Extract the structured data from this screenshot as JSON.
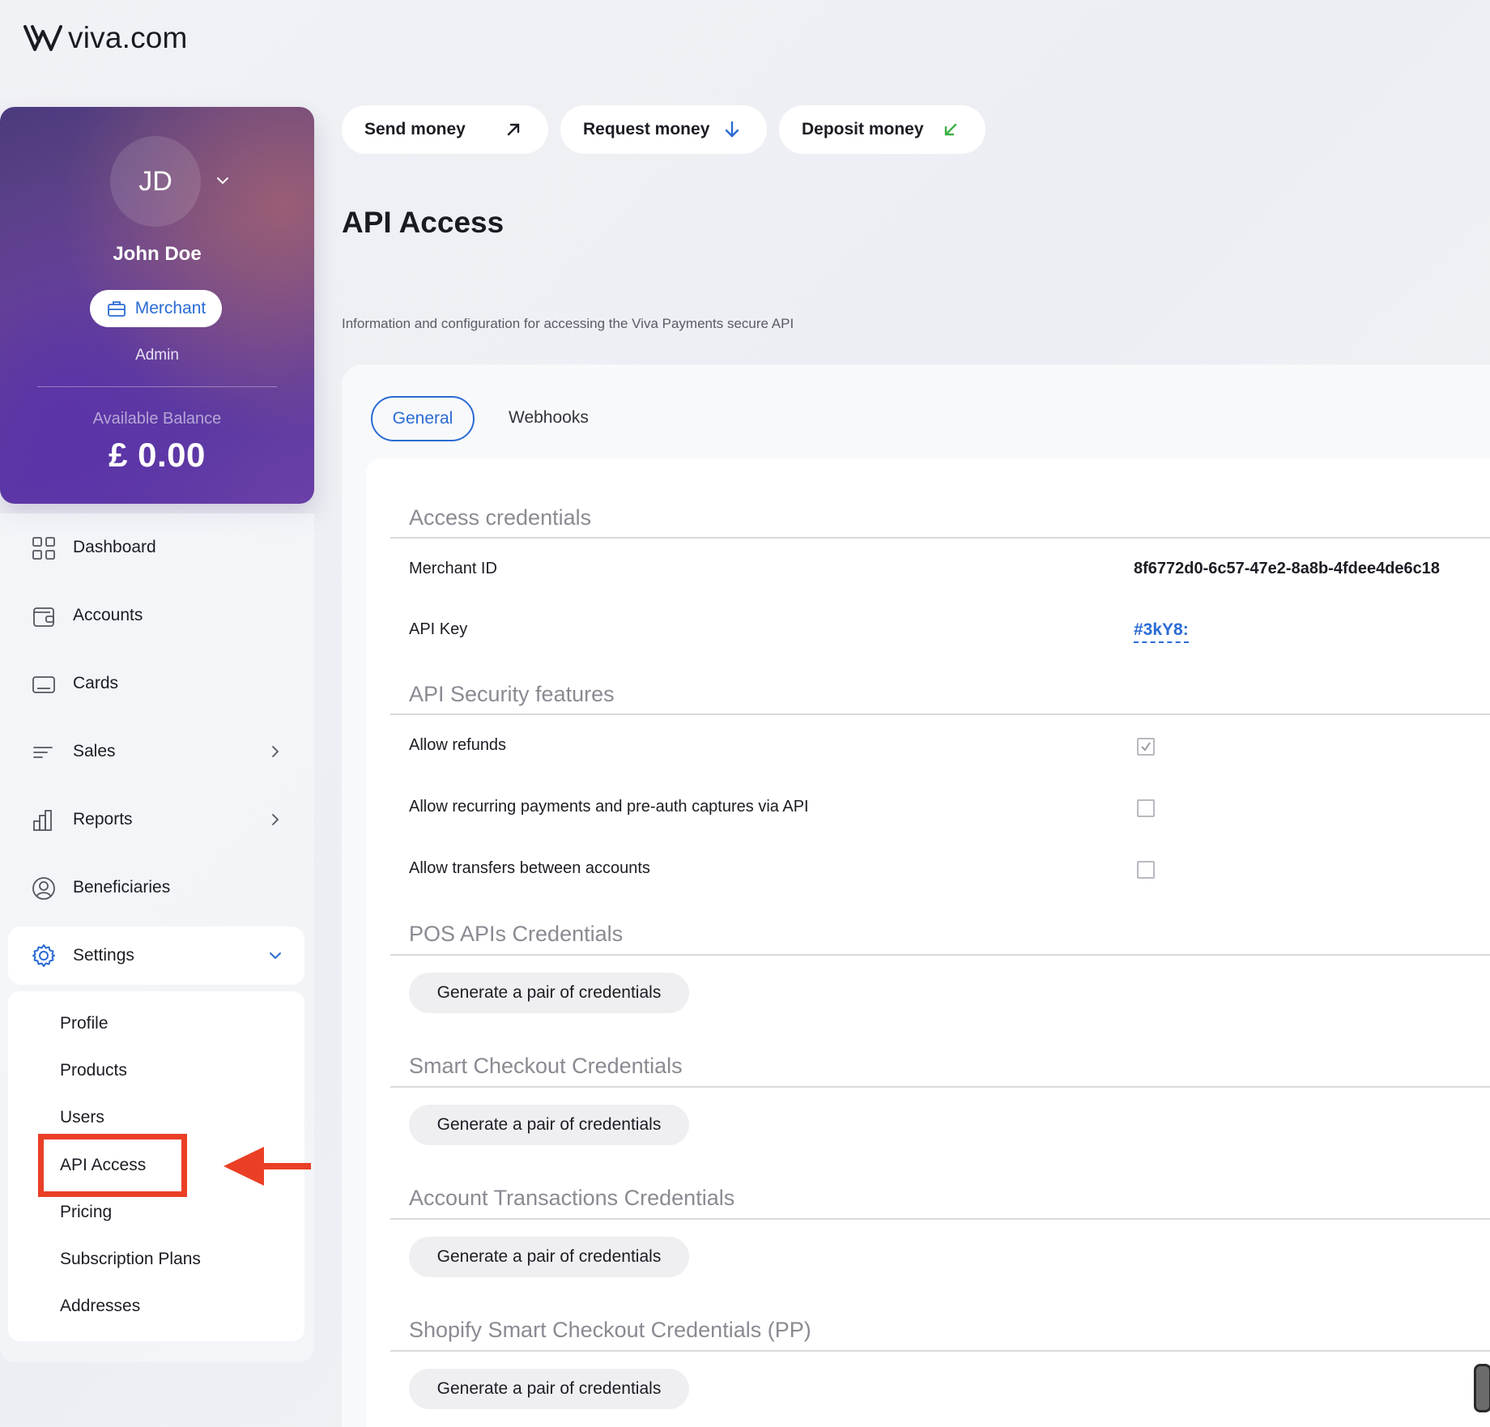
{
  "brand": {
    "logo_text": "viva.com"
  },
  "profile": {
    "initials": "JD",
    "name": "John Doe",
    "role": "Merchant",
    "access_level": "Admin",
    "balance_label": "Available Balance",
    "balance_value": "£ 0.00"
  },
  "nav": {
    "items": [
      {
        "label": "Dashboard",
        "icon": "grid-icon"
      },
      {
        "label": "Accounts",
        "icon": "wallet-icon"
      },
      {
        "label": "Cards",
        "icon": "card-icon"
      },
      {
        "label": "Sales",
        "icon": "lines-icon"
      },
      {
        "label": "Reports",
        "icon": "bar-chart-icon"
      },
      {
        "label": "Beneficiaries",
        "icon": "user-circle-icon"
      }
    ],
    "settings_label": "Settings",
    "settings_sub": [
      "Profile",
      "Products",
      "Users",
      "API Access",
      "Pricing",
      "Subscription Plans",
      "Addresses"
    ]
  },
  "actions": {
    "send": "Send money",
    "request": "Request money",
    "deposit": "Deposit money"
  },
  "page": {
    "title": "API Access",
    "subtitle": "Information and configuration for accessing the Viva Payments secure API"
  },
  "tabs": {
    "general": "General",
    "webhooks": "Webhooks"
  },
  "access_credentials": {
    "title": "Access credentials",
    "merchant_id_label": "Merchant ID",
    "merchant_id_value": "8f6772d0-6c57-47e2-8a8b-4fdee4de6c18",
    "api_key_label": "API Key",
    "api_key_value": "#3kY8:"
  },
  "security": {
    "title": "API Security features",
    "items": [
      {
        "label": "Allow refunds",
        "checked": true
      },
      {
        "label": "Allow recurring payments and pre-auth captures via API",
        "checked": false
      },
      {
        "label": "Allow transfers between accounts",
        "checked": false
      }
    ]
  },
  "credential_sections": [
    {
      "title": "POS APIs Credentials",
      "button": "Generate a pair of credentials"
    },
    {
      "title": "Smart Checkout Credentials",
      "button": "Generate a pair of credentials"
    },
    {
      "title": "Account Transactions Credentials",
      "button": "Generate a pair of credentials"
    },
    {
      "title": "Shopify Smart Checkout Credentials (PP)",
      "button": "Generate a pair of credentials"
    }
  ],
  "colors": {
    "accent": "#2a6bd4",
    "highlight": "#ea3f26",
    "deposit_arrow": "#3cb043"
  }
}
